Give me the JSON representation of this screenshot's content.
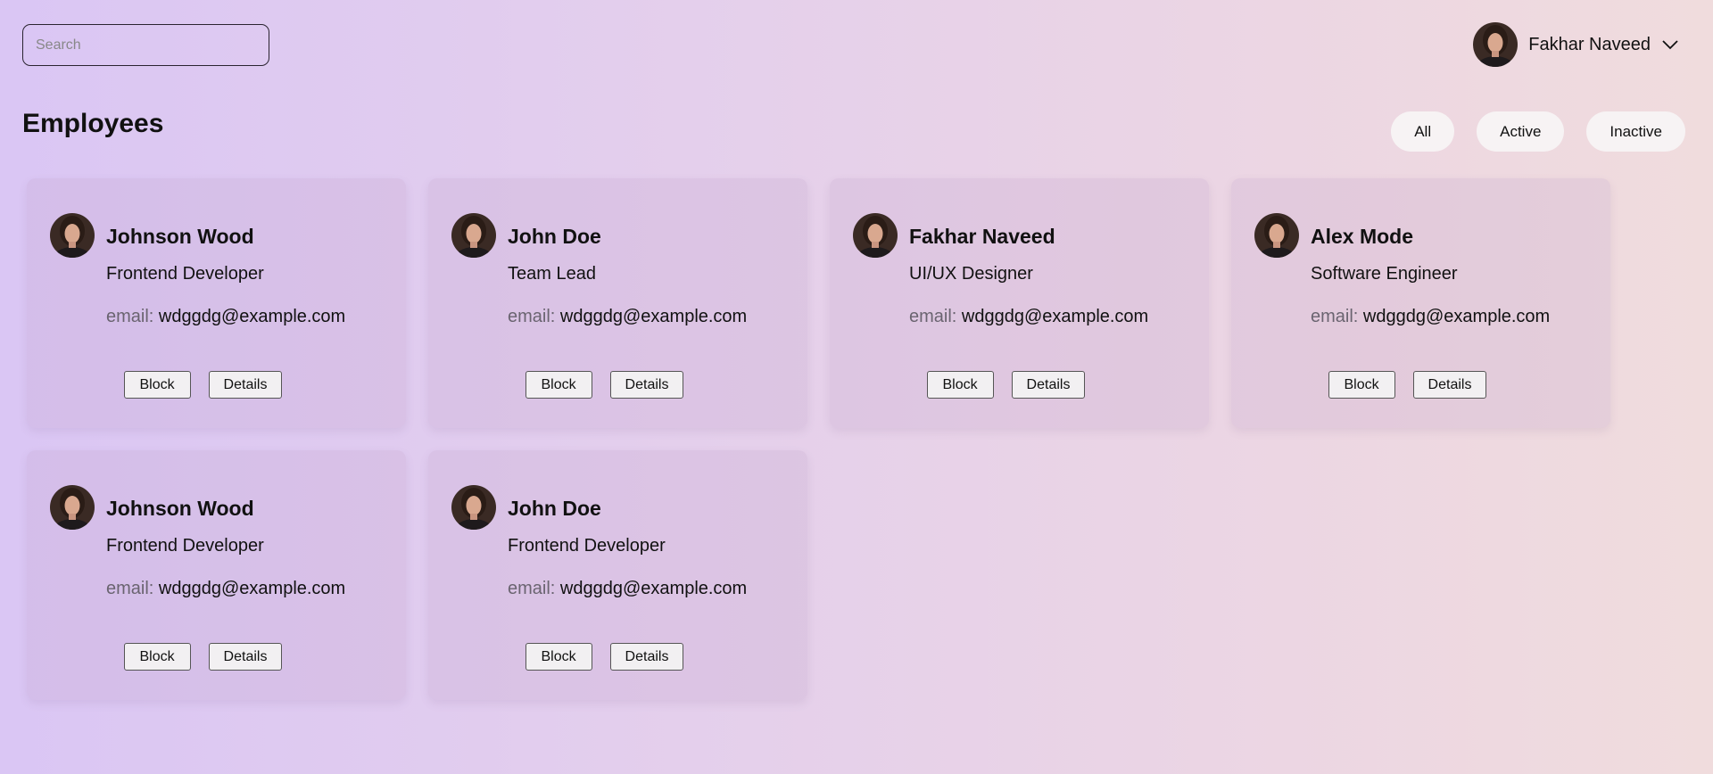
{
  "search": {
    "placeholder": "Search",
    "value": ""
  },
  "user": {
    "name": "Fakhar Naveed"
  },
  "page": {
    "title": "Employees"
  },
  "filters": [
    "All",
    "Active",
    "Inactive"
  ],
  "email_label": "email:",
  "actions": {
    "block": "Block",
    "details": "Details"
  },
  "employees": [
    {
      "name": "Johnson Wood",
      "role": "Frontend Developer",
      "email": "wdggdg@example.com"
    },
    {
      "name": "John Doe",
      "role": "Team Lead",
      "email": "wdggdg@example.com"
    },
    {
      "name": "Fakhar Naveed",
      "role": "UI/UX Designer",
      "email": "wdggdg@example.com"
    },
    {
      "name": "Alex Mode",
      "role": "Software Engineer",
      "email": "wdggdg@example.com"
    },
    {
      "name": "Johnson Wood",
      "role": "Frontend Developer",
      "email": "wdggdg@example.com"
    },
    {
      "name": "John Doe",
      "role": "Frontend Developer",
      "email": "wdggdg@example.com"
    }
  ],
  "colors": {
    "background_start": "#dac6f4",
    "background_end": "#f0dcdd",
    "filter_bg": "#f7f3f4"
  }
}
